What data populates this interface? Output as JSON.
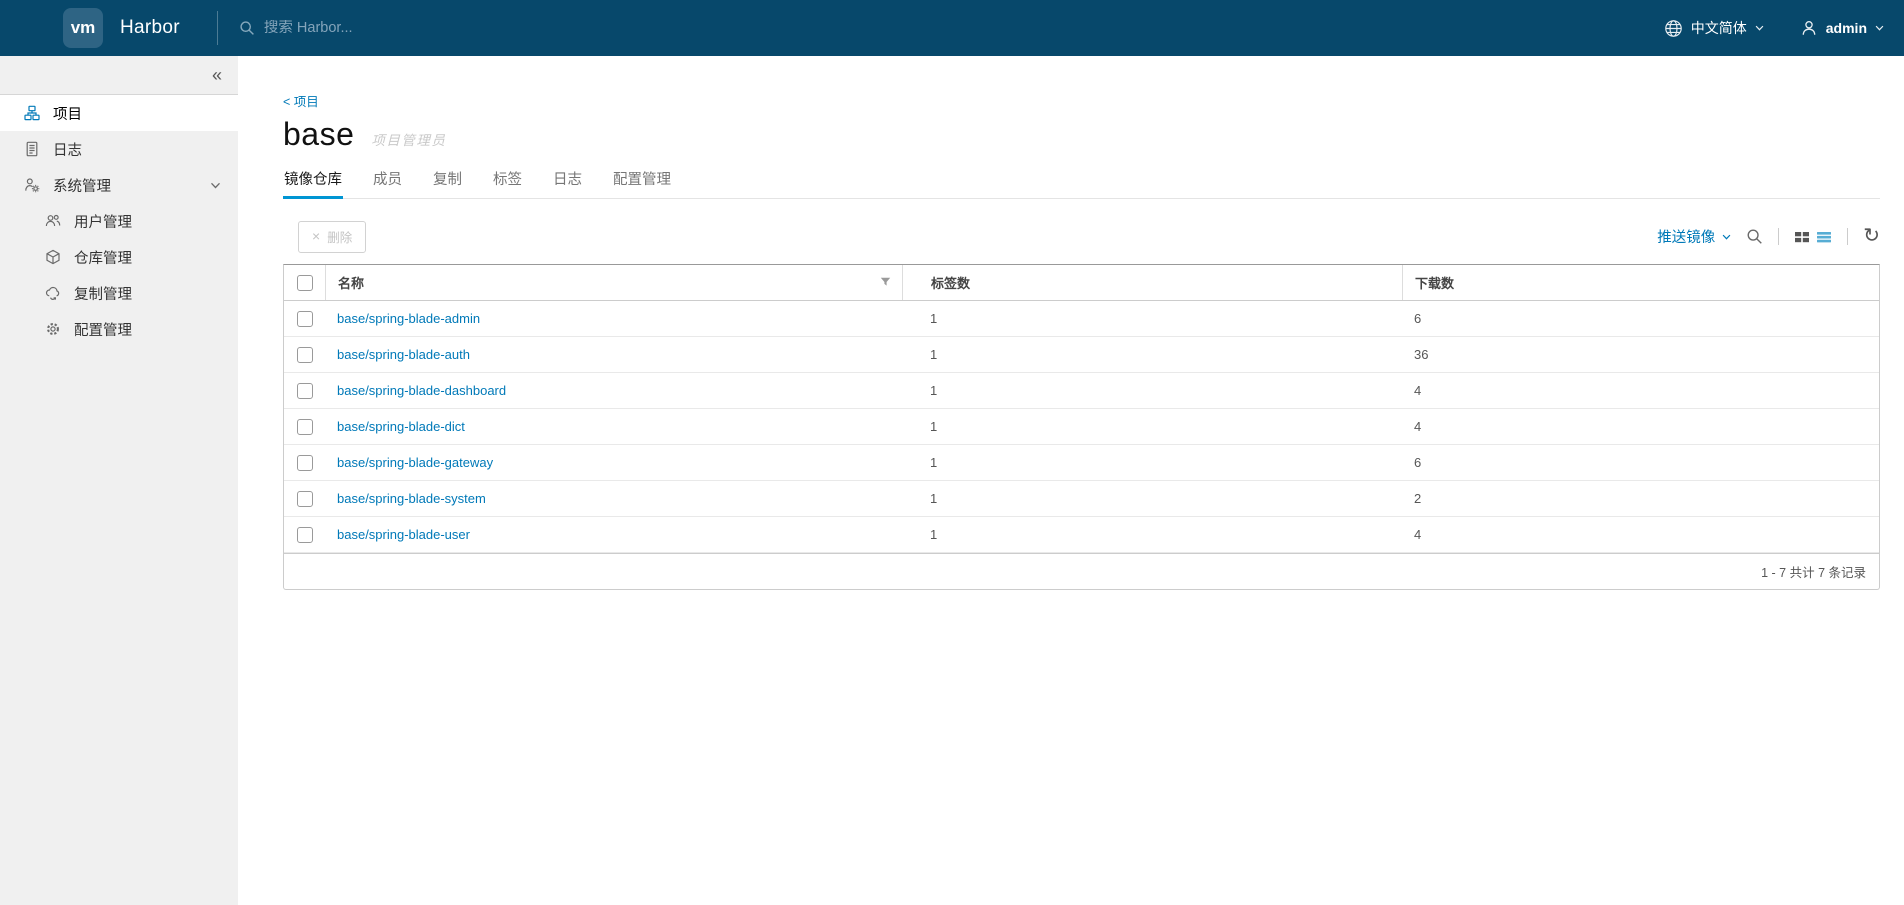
{
  "header": {
    "logo_text": "vm",
    "app_name": "Harbor",
    "search_placeholder": "搜索 Harbor...",
    "language": "中文简体",
    "user": "admin"
  },
  "sidebar": {
    "collapse_glyph": "«",
    "items": [
      {
        "label": "项目",
        "icon": "projects-icon",
        "active": true
      },
      {
        "label": "日志",
        "icon": "logs-icon",
        "active": false
      },
      {
        "label": "系统管理",
        "icon": "system-admin-icon",
        "active": false,
        "expanded": true
      }
    ],
    "sub_items": [
      {
        "label": "用户管理",
        "icon": "users-icon"
      },
      {
        "label": "仓库管理",
        "icon": "registry-icon"
      },
      {
        "label": "复制管理",
        "icon": "replication-icon"
      },
      {
        "label": "配置管理",
        "icon": "config-icon"
      }
    ]
  },
  "main": {
    "breadcrumb": "< 项目",
    "title": "base",
    "role_badge": "项目管理员",
    "tabs": [
      {
        "label": "镜像仓库",
        "active": true
      },
      {
        "label": "成员",
        "active": false
      },
      {
        "label": "复制",
        "active": false
      },
      {
        "label": "标签",
        "active": false
      },
      {
        "label": "日志",
        "active": false
      },
      {
        "label": "配置管理",
        "active": false
      }
    ],
    "toolbar": {
      "delete_label": "删除",
      "delete_glyph": "×",
      "push_image_label": "推送镜像",
      "refresh_glyph": "↻"
    },
    "table": {
      "columns": [
        "名称",
        "标签数",
        "下载数"
      ],
      "rows": [
        {
          "name": "base/spring-blade-admin",
          "tags": "1",
          "pulls": "6"
        },
        {
          "name": "base/spring-blade-auth",
          "tags": "1",
          "pulls": "36"
        },
        {
          "name": "base/spring-blade-dashboard",
          "tags": "1",
          "pulls": "4"
        },
        {
          "name": "base/spring-blade-dict",
          "tags": "1",
          "pulls": "4"
        },
        {
          "name": "base/spring-blade-gateway",
          "tags": "1",
          "pulls": "6"
        },
        {
          "name": "base/spring-blade-system",
          "tags": "1",
          "pulls": "2"
        },
        {
          "name": "base/spring-blade-user",
          "tags": "1",
          "pulls": "4"
        }
      ],
      "footer": "1 - 7 共计 7 条记录"
    }
  },
  "colors": {
    "header_bg": "#07486B",
    "logo_box_bg": "#2E6484",
    "accent_blue": "#0079B8",
    "tab_underline": "#0095D3",
    "sidebar_bg": "#F0F0F0"
  }
}
